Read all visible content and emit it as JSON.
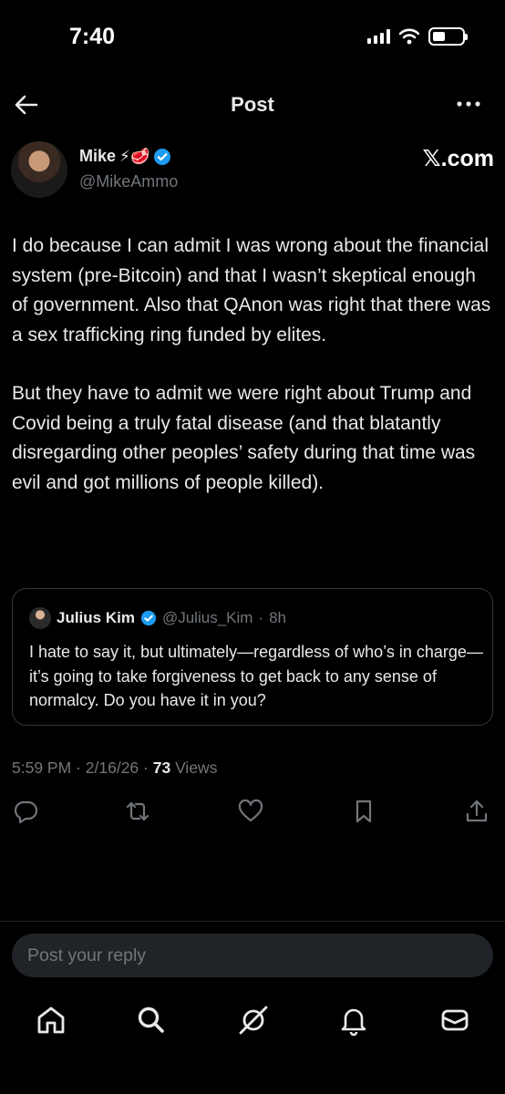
{
  "status_bar": {
    "time": "7:40"
  },
  "header": {
    "title": "Post"
  },
  "author": {
    "name": "Mike",
    "name_emojis": "⚡🥩",
    "handle": "@MikeAmmo",
    "source_label": "𝕏.com"
  },
  "post": {
    "paragraphs": [
      "I do because I can admit I was wrong about the financial system (pre-Bitcoin) and that I wasn’t skeptical enough of government. Also that QAnon was right that there was a sex trafficking ring funded by elites.",
      "But they have to admit we were right about Trump and Covid being a truly fatal disease (and that blatantly disregarding other peoples’ safety during that time was evil and got millions of people killed)."
    ]
  },
  "quote": {
    "name": "Julius Kim",
    "handle": "@Julius_Kim",
    "time": "8h",
    "text": "I hate to say it, but ultimately—regardless of who’s in charge—it’s going to take forgiveness to get back to any sense of normalcy. Do you have it in you?"
  },
  "meta": {
    "time": "5:59 PM",
    "date": "2/16/26",
    "views_count": "73",
    "views_label": "Views"
  },
  "actions": [
    "reply-icon",
    "repost-icon",
    "like-icon",
    "bookmark-icon",
    "share-icon"
  ],
  "reply": {
    "placeholder": "Post your reply"
  },
  "tabbar": [
    "home-icon",
    "search-icon",
    "grok-icon",
    "notifications-icon",
    "messages-icon"
  ],
  "colors": {
    "background": "#000000",
    "text": "#e7e9ea",
    "secondary": "#71767b",
    "verified": "#1d9bf0",
    "border": "#333639"
  }
}
